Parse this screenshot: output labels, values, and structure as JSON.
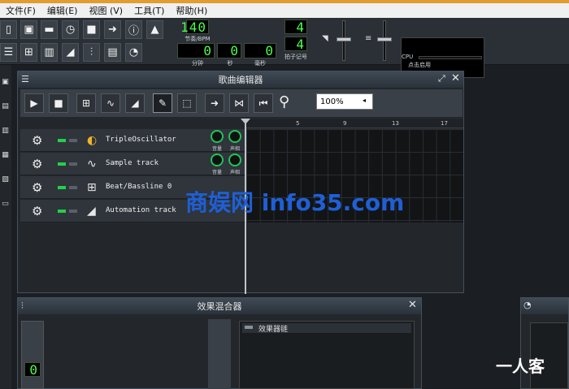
{
  "menu": [
    "文件(F)",
    "编辑(E)",
    "视图 (V)",
    "工具(T)",
    "帮助(H)"
  ],
  "toolbar": {
    "tempo_value": "140",
    "tempo_label": "节奏/BPM",
    "time_min": "0",
    "time_sec": "0",
    "time_ms": "0",
    "label_min": "分钟",
    "label_sec": "秒",
    "label_ms": "毫秒",
    "timesig_num": "4",
    "timesig_den": "4",
    "timesig_label": "拍子记号",
    "cpu_hint": "点击启用",
    "cpu_label": "CPU"
  },
  "song_editor": {
    "title": "歌曲编辑器",
    "zoom": "100%",
    "timeline_marks": [
      "5",
      "9",
      "13",
      "17"
    ],
    "tracks": [
      {
        "name": "TripleOscillator",
        "icon": "triple-oscillator-icon",
        "knob1": "音量",
        "knob2": "声相"
      },
      {
        "name": "Sample track",
        "icon": "waveform-icon",
        "knob1": "音量",
        "knob2": "声相"
      },
      {
        "name": "Beat/Bassline 0",
        "icon": "beat-grid-icon"
      },
      {
        "name": "Automation track",
        "icon": "automation-ramp-icon"
      }
    ]
  },
  "fx_mixer": {
    "title": "效果混合器",
    "lcd": "0",
    "chain_label": "效果器链"
  },
  "watermarks": {
    "center": "商娱网 info35.com",
    "corner": "一人客"
  },
  "colors": {
    "accent": "#e39c2f",
    "lcd_green": "#4cff4c",
    "led_green": "#22d04a",
    "watermark_blue": "#1f5fd6"
  }
}
